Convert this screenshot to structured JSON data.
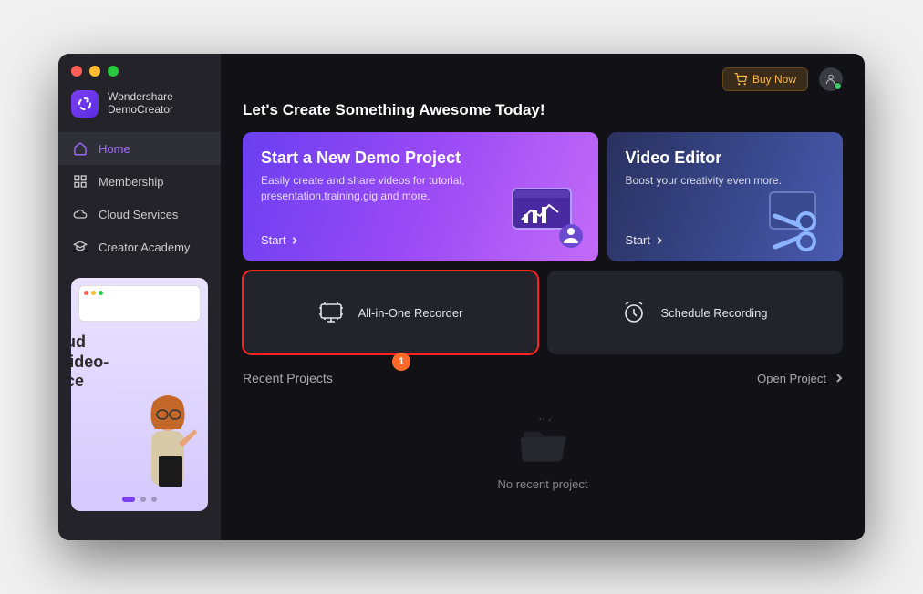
{
  "app": {
    "brand_line1": "Wondershare",
    "brand_line2": "DemoCreator"
  },
  "sidebar": {
    "items": [
      {
        "label": "Home"
      },
      {
        "label": "Membership"
      },
      {
        "label": "Cloud Services"
      },
      {
        "label": "Creator Academy"
      }
    ],
    "promo": {
      "line1": "ud",
      "line2": "'ideo-",
      "line3": "ce"
    }
  },
  "header": {
    "buy_label": "Buy Now"
  },
  "headline": "Let's Create Something Awesome Today!",
  "hero": {
    "demo": {
      "title": "Start a New Demo Project",
      "desc": "Easily create and share videos for tutorial, presentation,training,gig and more.",
      "cta": "Start"
    },
    "editor": {
      "title": "Video Editor",
      "desc": "Boost your creativity even more.",
      "cta": "Start"
    }
  },
  "tools": {
    "recorder": "All-in-One Recorder",
    "schedule": "Schedule Recording"
  },
  "annotation": {
    "badge": "1"
  },
  "recent": {
    "title": "Recent Projects",
    "open": "Open Project",
    "empty": "No recent project"
  }
}
